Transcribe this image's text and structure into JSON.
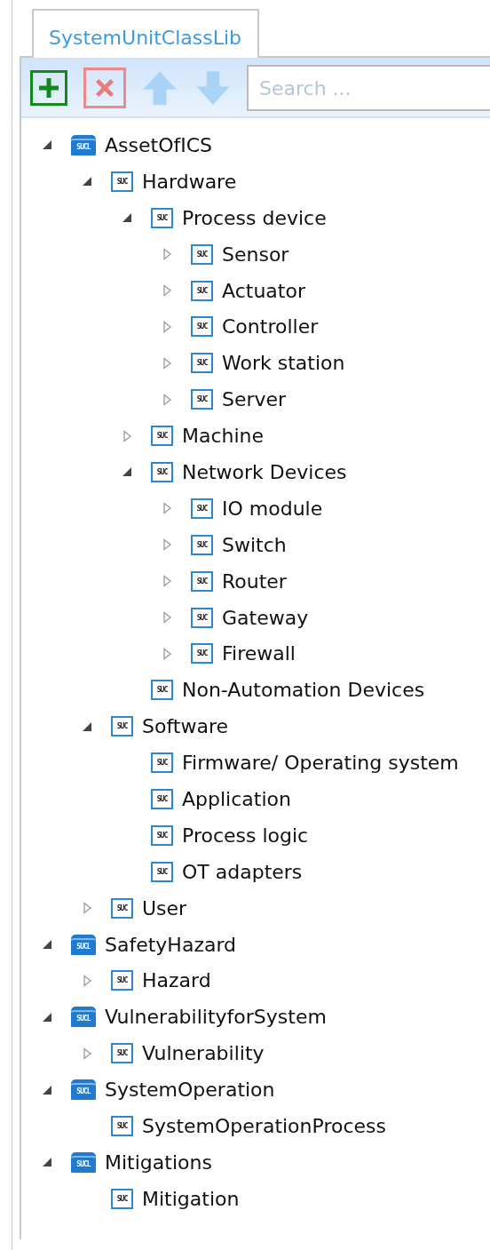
{
  "tabs": [
    {
      "label": "SystemUnitClassLib",
      "selected": true
    }
  ],
  "toolbar": {
    "search": {
      "placeholder": "Search ..."
    }
  },
  "tree": [
    {
      "label": "AssetOfICS",
      "icon_text": "SUCL",
      "kind": "library",
      "expanded": true,
      "children": [
        {
          "label": "Hardware",
          "icon_text": "SUC",
          "kind": "class",
          "expanded": true,
          "children": [
            {
              "label": "Process device",
              "icon_text": "SUC",
              "kind": "class",
              "expanded": true,
              "children": [
                {
                  "label": "Sensor",
                  "icon_text": "SUC",
                  "kind": "class",
                  "expanded": false
                },
                {
                  "label": "Actuator",
                  "icon_text": "SUC",
                  "kind": "class",
                  "expanded": false
                },
                {
                  "label": "Controller",
                  "icon_text": "SUC",
                  "kind": "class",
                  "expanded": false
                },
                {
                  "label": "Work station",
                  "icon_text": "SUC",
                  "kind": "class",
                  "expanded": false
                },
                {
                  "label": "Server",
                  "icon_text": "SUC",
                  "kind": "class",
                  "expanded": false
                }
              ]
            },
            {
              "label": "Machine",
              "icon_text": "SUC",
              "kind": "class",
              "expanded": false
            },
            {
              "label": "Network Devices",
              "icon_text": "SUC",
              "kind": "class",
              "expanded": true,
              "children": [
                {
                  "label": "IO module",
                  "icon_text": "SUC",
                  "kind": "class",
                  "expanded": false
                },
                {
                  "label": "Switch",
                  "icon_text": "SUC",
                  "kind": "class",
                  "expanded": false
                },
                {
                  "label": "Router",
                  "icon_text": "SUC",
                  "kind": "class",
                  "expanded": false
                },
                {
                  "label": "Gateway",
                  "icon_text": "SUC",
                  "kind": "class",
                  "expanded": false
                },
                {
                  "label": "Firewall",
                  "icon_text": "SUC",
                  "kind": "class",
                  "expanded": false
                }
              ]
            },
            {
              "label": "Non-Automation Devices",
              "icon_text": "SUC",
              "kind": "class"
            }
          ]
        },
        {
          "label": "Software",
          "icon_text": "SUC",
          "kind": "class",
          "expanded": true,
          "children": [
            {
              "label": "Firmware/ Operating system",
              "icon_text": "SUC",
              "kind": "class"
            },
            {
              "label": "Application",
              "icon_text": "SUC",
              "kind": "class"
            },
            {
              "label": "Process logic",
              "icon_text": "SUC",
              "kind": "class"
            },
            {
              "label": "OT adapters",
              "icon_text": "SUC",
              "kind": "class"
            }
          ]
        },
        {
          "label": "User",
          "icon_text": "SUC",
          "kind": "class",
          "expanded": false
        }
      ]
    },
    {
      "label": "SafetyHazard",
      "icon_text": "SUCL",
      "kind": "library",
      "expanded": true,
      "children": [
        {
          "label": "Hazard",
          "icon_text": "SUC",
          "kind": "class",
          "expanded": false
        }
      ]
    },
    {
      "label": "VulnerabilityforSystem",
      "icon_text": "SUCL",
      "kind": "library",
      "expanded": true,
      "children": [
        {
          "label": "Vulnerability",
          "icon_text": "SUC",
          "kind": "class",
          "expanded": false
        }
      ]
    },
    {
      "label": "SystemOperation",
      "icon_text": "SUCL",
      "kind": "library",
      "expanded": true,
      "children": [
        {
          "label": "SystemOperationProcess",
          "icon_text": "SUC",
          "kind": "class"
        }
      ]
    },
    {
      "label": "Mitigations",
      "icon_text": "SUCL",
      "kind": "library",
      "expanded": true,
      "children": [
        {
          "label": "Mitigation",
          "icon_text": "SUC",
          "kind": "class"
        }
      ]
    }
  ]
}
